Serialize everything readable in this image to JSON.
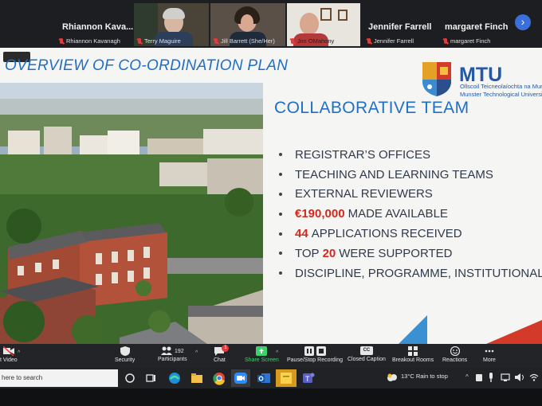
{
  "participants": [
    {
      "big_name": "Rhiannon Kava...",
      "label": "Rhiannon Kavanagh",
      "muted": true
    },
    {
      "label": "Terry Maguire",
      "muted": true
    },
    {
      "label": "Jill Barrett (She/Her)",
      "muted": true
    },
    {
      "label": "Jim OMahony",
      "muted": true
    },
    {
      "big_name": "Jennifer Farrell",
      "label": "Jennifer Farrell",
      "muted": true
    },
    {
      "big_name": "margaret Finch",
      "label": "margaret Finch",
      "muted": true
    }
  ],
  "slide": {
    "title": "OVERVIEW OF CO-ORDINATION PLAN",
    "logo": {
      "name": "MTU",
      "irish": "Ollscoil Teicneolaíochta na Mum",
      "english": "Munster Technological Universit"
    },
    "section_heading": "COLLABORATIVE TEAM",
    "bullets": [
      {
        "text": "REGISTRAR’S OFFICES"
      },
      {
        "text": "TEACHING AND LEARNING TEAMS"
      },
      {
        "text": "EXTERNAL REVIEWERS"
      },
      {
        "highlight": "€190,000",
        "text": "MADE AVAILABLE"
      },
      {
        "highlight": "44",
        "text": "APPLICATIONS RECEIVED"
      },
      {
        "prefix": "TOP",
        "highlight": "20",
        "text": "WERE SUPPORTED"
      },
      {
        "text": "DISCIPLINE, PROGRAMME, INSTITUTIONAL"
      }
    ],
    "accent_colors": {
      "title": "#1f6fc6",
      "highlight": "#d4281e"
    }
  },
  "toolbar": {
    "video_label": "t Video",
    "security_label": "Security",
    "participants_label": "Participants",
    "participants_count": "192",
    "chat_label": "Chat",
    "chat_badge": "1",
    "share_label": "Share Screen",
    "record_label": "Pause/Stop Recording",
    "caption_label": "Closed Caption",
    "caption_badge": "CC",
    "breakout_label": "Breakout Rooms",
    "reactions_label": "Reactions",
    "more_label": "More"
  },
  "taskbar": {
    "search_placeholder": "here to search",
    "weather": "13°C  Rain to stop"
  }
}
